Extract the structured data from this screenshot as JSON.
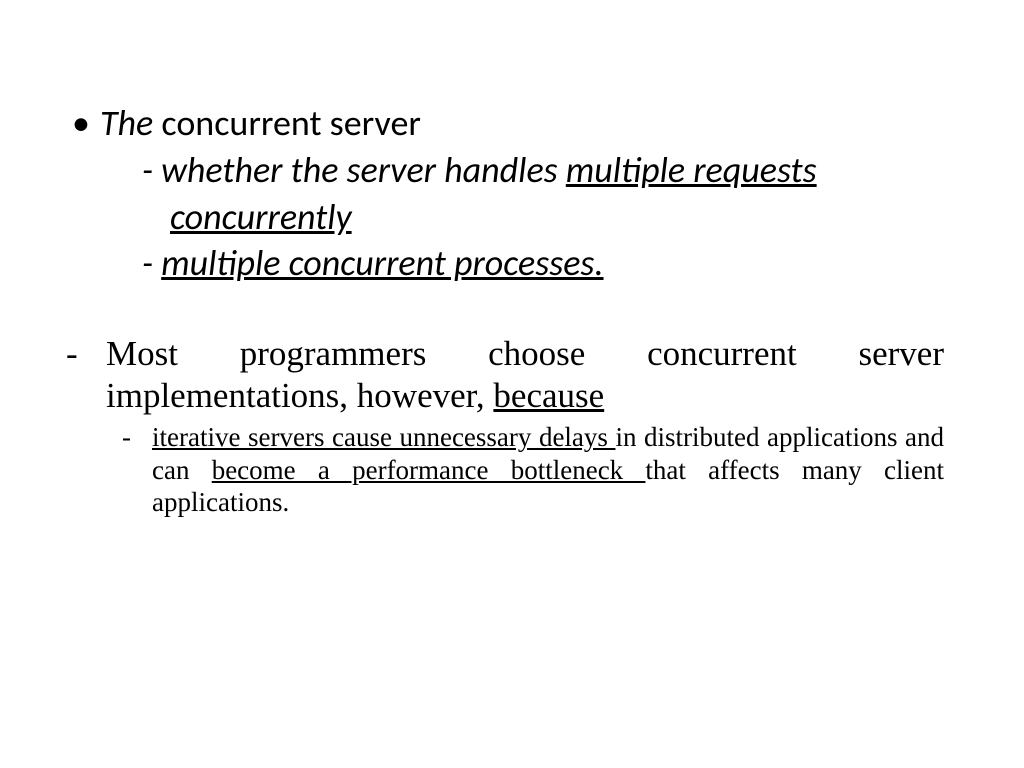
{
  "p1": {
    "lead_italic": "The",
    "lead_rest": " concurrent server",
    "sub1_prefix": "- ",
    "sub1_plain": "whether  the server handles ",
    "sub1_underlined": "multiple requests",
    "sub1b_underlined": "concurrently",
    "sub2_prefix": "- ",
    "sub2_underlined": "multiple concurrent processes."
  },
  "p2": {
    "dash": "-",
    "line_plain1": "Most programmers choose concurrent server implementations, however, ",
    "line_u1": "because",
    "sub_dash": "-",
    "sub_u1": "iterative servers cause unnecessary delays ",
    "sub_plain1": "in distributed applications and can ",
    "sub_u2": "become a performance bottleneck ",
    "sub_plain2": "that affects many client applications."
  }
}
